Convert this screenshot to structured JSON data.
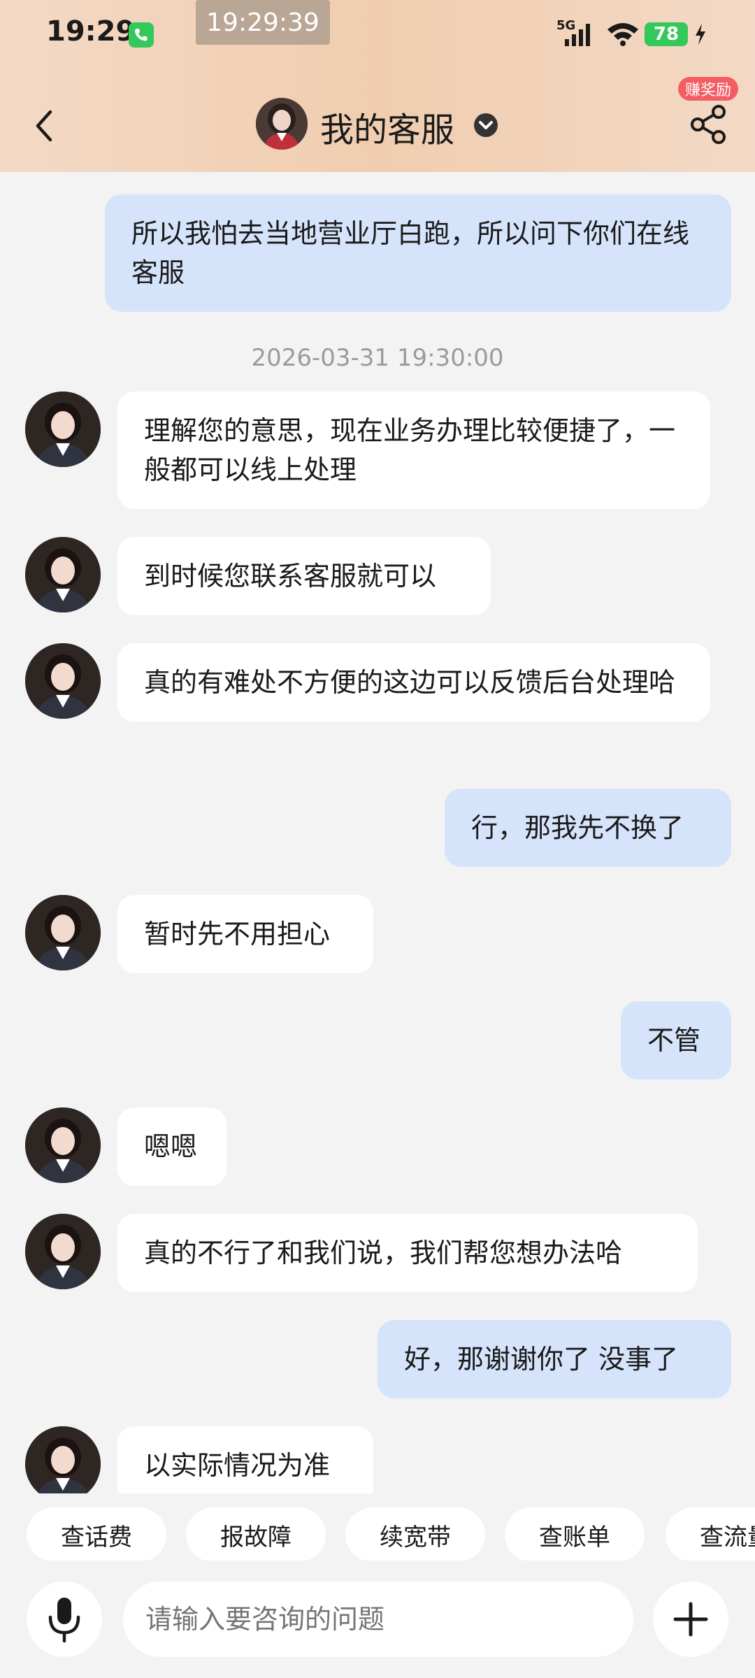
{
  "status_bar": {
    "time": "19:29",
    "recording_time": "19:29:39",
    "network": "5G",
    "battery": "78"
  },
  "header": {
    "title": "我的客服",
    "reward_badge": "赚奖励"
  },
  "chat": {
    "messages": [
      {
        "side": "out",
        "text": "所以我怕去当地营业厅白跑，所以问下你们在线客服"
      },
      {
        "timestamp": "2026-03-31 19:30:00"
      },
      {
        "side": "in",
        "text": "理解您的意思，现在业务办理比较便捷了，一般都可以线上处理"
      },
      {
        "side": "in",
        "text": "到时候您联系客服就可以"
      },
      {
        "side": "in",
        "text": "真的有难处不方便的这边可以反馈后台处理哈"
      },
      {
        "side": "out",
        "text": "行，那我先不换了"
      },
      {
        "side": "in",
        "text": "暂时先不用担心"
      },
      {
        "side": "out",
        "text": "不管"
      },
      {
        "side": "in",
        "text": "嗯嗯"
      },
      {
        "side": "in",
        "text": "真的不行了和我们说，我们帮您想办法哈"
      },
      {
        "side": "out",
        "text": "好，那谢谢你了 没事了"
      },
      {
        "side": "in",
        "text": "以实际情况为准"
      }
    ]
  },
  "quick_replies": [
    "查话费",
    "报故障",
    "续宽带",
    "查账单",
    "查流量"
  ],
  "input": {
    "placeholder": "请输入要咨询的问题"
  },
  "colors": {
    "header_bg": "#f0cdb0",
    "outgoing_bubble": "#d6e4fb",
    "incoming_bubble": "#ffffff",
    "badge": "#f35d63",
    "battery": "#34c759"
  }
}
